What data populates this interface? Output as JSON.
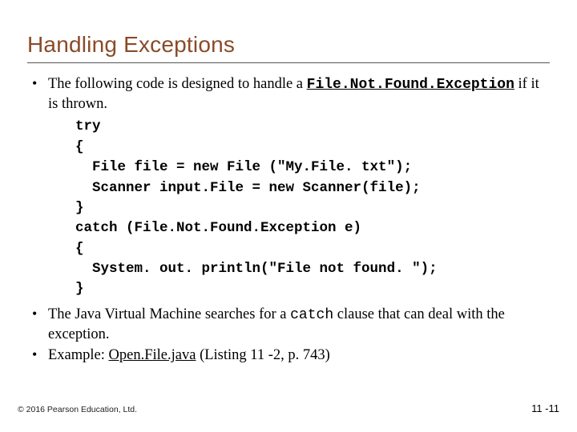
{
  "title": "Handling Exceptions",
  "bullet1": {
    "pre": "The following code is designed to handle a ",
    "code": "File.Not.Found.Exception",
    "post": " if it is thrown."
  },
  "code": {
    "l1": "try",
    "l2": "{",
    "l3": "  File file = new File (\"My.File. txt\");",
    "l4": "  Scanner input.File = new Scanner(file);",
    "l5": "}",
    "l6": "catch (File.Not.Found.Exception e)",
    "l7": "{",
    "l8": "  System. out. println(\"File not found. \");",
    "l9": "}"
  },
  "bullet2": {
    "pre": "The Java Virtual Machine searches for a ",
    "code": "catch",
    "post": " clause that can deal with the exception."
  },
  "bullet3": {
    "pre": "Example: ",
    "link": "Open.File.java",
    "post": " (Listing 11 -2, p. 743)"
  },
  "footer": {
    "copyright": "© 2016 Pearson Education, Ltd.",
    "pagenum": "11 -11"
  }
}
